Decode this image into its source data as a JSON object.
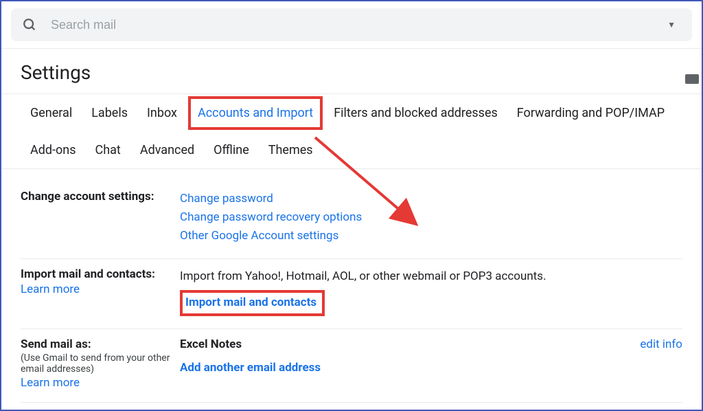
{
  "search": {
    "placeholder": "Search mail"
  },
  "header": {
    "title": "Settings"
  },
  "tabs": {
    "row1": [
      "General",
      "Labels",
      "Inbox",
      "Accounts and Import",
      "Filters and blocked addresses",
      "Forwarding and POP/IMAP"
    ],
    "row2": [
      "Add-ons",
      "Chat",
      "Advanced",
      "Offline",
      "Themes"
    ],
    "active": "Accounts and Import"
  },
  "sections": {
    "changeAccount": {
      "label": "Change account settings:",
      "links": [
        "Change password",
        "Change password recovery options",
        "Other Google Account settings"
      ]
    },
    "importMail": {
      "label": "Import mail and contacts:",
      "learnMore": "Learn more",
      "description": "Import from Yahoo!, Hotmail, AOL, or other webmail or POP3 accounts.",
      "action": "Import mail and contacts"
    },
    "sendMailAs": {
      "label": "Send mail as:",
      "sub": "(Use Gmail to send from your other email addresses)",
      "learnMore": "Learn more",
      "accountName": "Excel Notes",
      "addAnother": "Add another email address",
      "editInfo": "edit info"
    }
  }
}
